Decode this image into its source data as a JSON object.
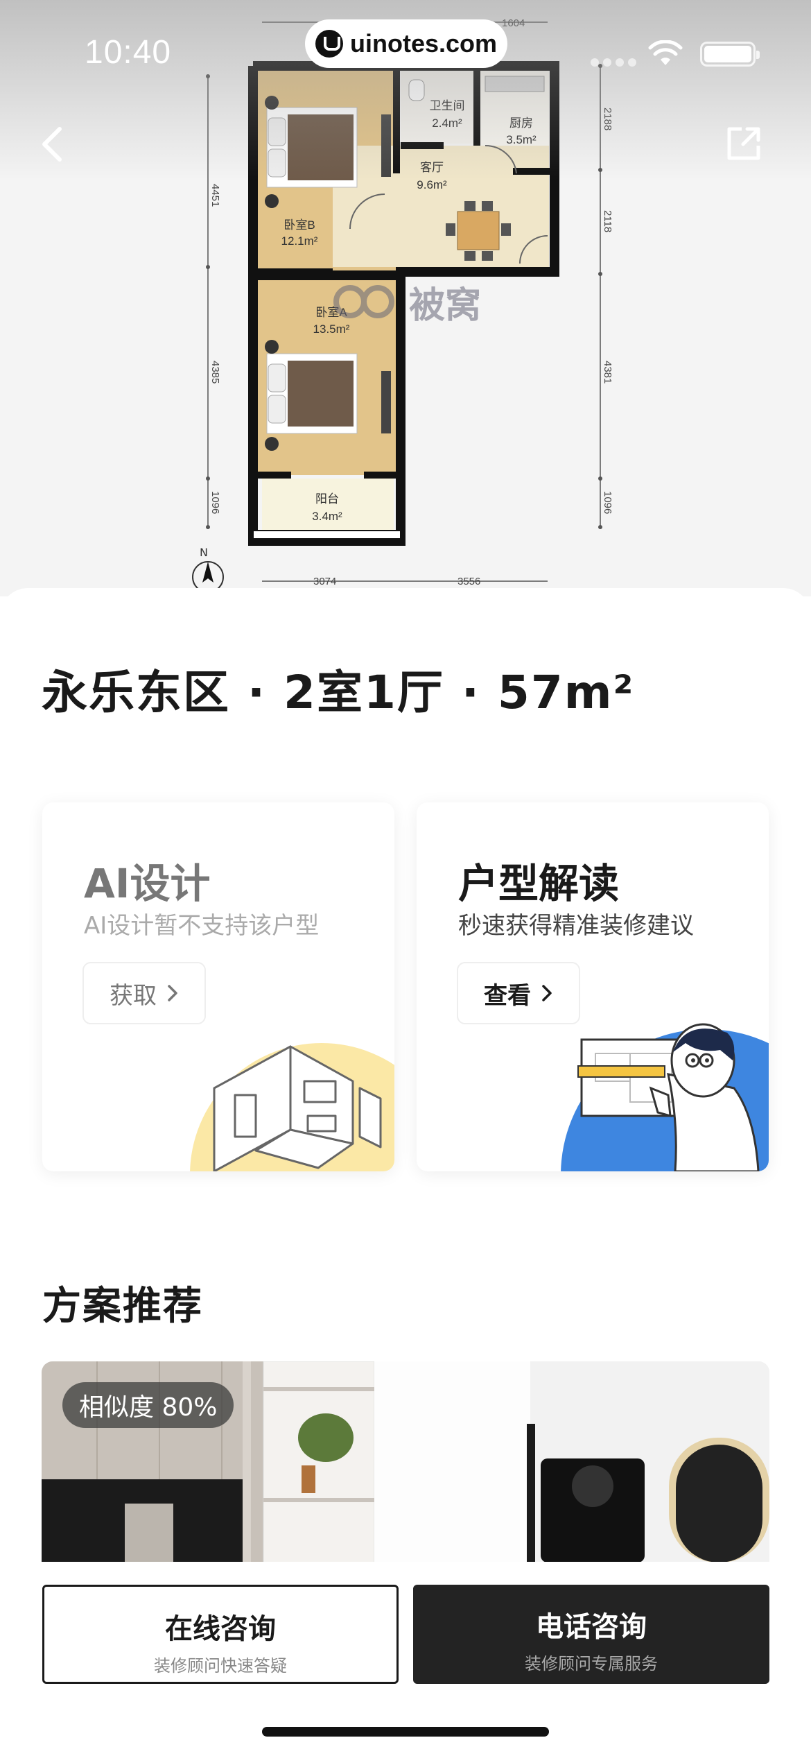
{
  "status_bar": {
    "time": "10:40",
    "watermark": "uinotes.com"
  },
  "floor_plan": {
    "rooms": [
      {
        "name": "卫生间",
        "area": "2.4m²"
      },
      {
        "name": "厨房",
        "area": "3.5m²"
      },
      {
        "name": "客厅",
        "area": "9.6m²"
      },
      {
        "name": "卧室B",
        "area": "12.1m²"
      },
      {
        "name": "卧室A",
        "area": "13.5m²"
      },
      {
        "name": "阳台",
        "area": "3.4m²"
      }
    ],
    "dimensions": {
      "top_right": "1604",
      "left": [
        "4451",
        "4385",
        "1096"
      ],
      "right": [
        "2188",
        "2118",
        "4381",
        "1096"
      ],
      "bottom": [
        "3074",
        "3556"
      ]
    },
    "compass": "N",
    "brand_watermark": "被窝"
  },
  "house_title": "永乐东区 · 2室1厅 · 57m²",
  "cards": [
    {
      "title": "AI设计",
      "subtitle": "AI设计暂不支持该户型",
      "button": "获取"
    },
    {
      "title": "户型解读",
      "subtitle": "秒速获得精准装修建议",
      "button": "查看"
    }
  ],
  "recommend": {
    "title": "方案推荐",
    "similarity": "相似度 80%"
  },
  "bottom_actions": {
    "online": {
      "label": "在线咨询",
      "sub": "装修顾问快速答疑"
    },
    "phone": {
      "label": "电话咨询",
      "sub": "装修顾问专属服务"
    }
  },
  "colors": {
    "accent_blue": "#3e86e0",
    "accent_yellow": "#fbe8a6",
    "dark": "#232323"
  }
}
